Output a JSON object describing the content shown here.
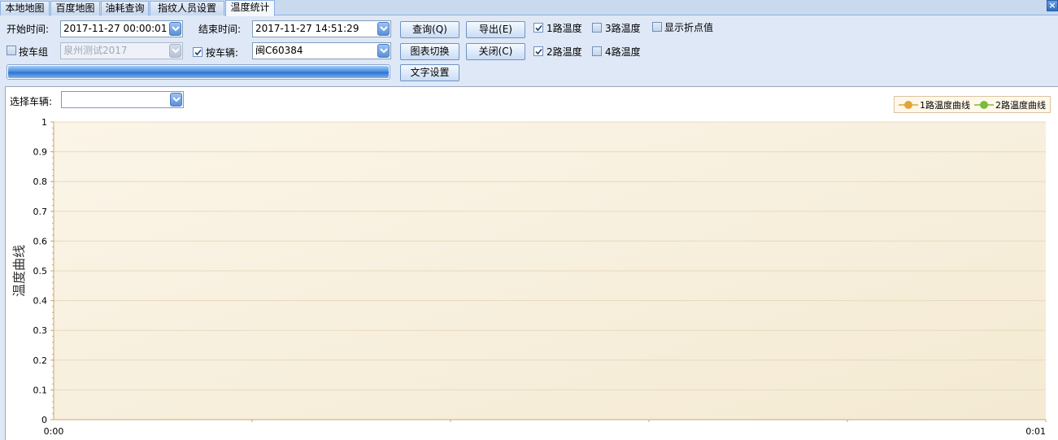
{
  "tabs": [
    {
      "label": "本地地图"
    },
    {
      "label": "百度地图"
    },
    {
      "label": "油耗查询"
    },
    {
      "label": "指纹人员设置"
    },
    {
      "label": "温度统计"
    }
  ],
  "filters": {
    "start_label": "开始时间:",
    "start_value": "2017-11-27 00:00:01",
    "end_label": "结束时间:",
    "end_value": "2017-11-27 14:51:29",
    "group_label": "按车组",
    "group_checked": false,
    "group_value": "泉州测试2017",
    "vehicle_label": "按车辆:",
    "vehicle_checked": true,
    "vehicle_value": "闽C60384",
    "progress": 1.0
  },
  "buttons": {
    "query": "查询(Q)",
    "export": "导出(E)",
    "switch_chart": "图表切换",
    "close": "关闭(C)",
    "text_settings": "文字设置"
  },
  "options": {
    "temp1": {
      "label": "1路温度",
      "checked": true
    },
    "temp2": {
      "label": "2路温度",
      "checked": true
    },
    "temp3": {
      "label": "3路温度",
      "checked": false
    },
    "temp4": {
      "label": "4路温度",
      "checked": false
    },
    "show_points": {
      "label": "显示折点值",
      "checked": false
    }
  },
  "vehicle_select": {
    "label": "选择车辆:",
    "value": ""
  },
  "chart_data": {
    "type": "line",
    "title": "",
    "xlabel": "",
    "ylabel": "温度曲线",
    "x_ticks": [
      "0:00",
      "0:01"
    ],
    "xlim": [
      "0:00",
      "0:01"
    ],
    "ylim": [
      0,
      1
    ],
    "y_ticks": [
      0,
      0.1,
      0.2,
      0.3,
      0.4,
      0.5,
      0.6,
      0.7,
      0.8,
      0.9,
      1
    ],
    "grid": true,
    "legend_position": "top-right",
    "series": [
      {
        "name": "1路温度曲线",
        "color": "#e0a43a",
        "values": []
      },
      {
        "name": "2路温度曲线",
        "color": "#7dbb3b",
        "values": []
      }
    ]
  },
  "colors": {
    "plot_bg_top": "#fbf5e8",
    "plot_bg_bottom": "#f4ead3",
    "axis": "#c9a873",
    "grid": "#e8d9bd"
  }
}
